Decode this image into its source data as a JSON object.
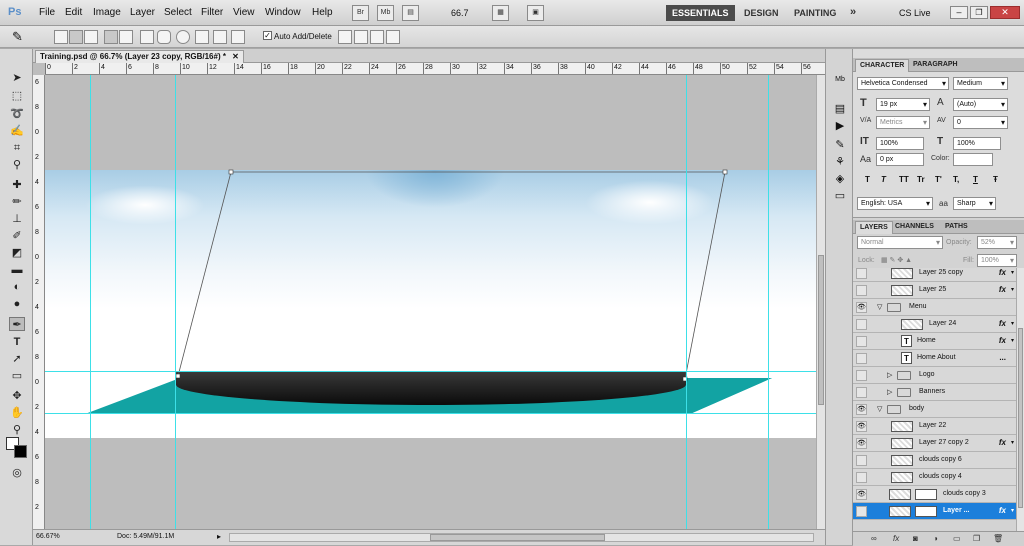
{
  "menubar": {
    "app_logo": "Ps",
    "items": [
      "File",
      "Edit",
      "Image",
      "Layer",
      "Select",
      "Filter",
      "View",
      "Window",
      "Help"
    ],
    "bridge": "Br",
    "minibridge": "Mb",
    "zoom": "66.7",
    "workspaces": [
      "ESSENTIALS",
      "DESIGN",
      "PAINTING"
    ],
    "more": "»",
    "cslive": "CS Live"
  },
  "options": {
    "auto_add_delete": "Auto Add/Delete",
    "auto_checked": true
  },
  "document": {
    "tab_title": "Training.psd @ 66.7% (Layer 23 copy, RGB/16#) *",
    "ruler_marks": [
      "0",
      "2",
      "4",
      "6",
      "8",
      "10",
      "12",
      "14",
      "16",
      "18",
      "20",
      "22",
      "24",
      "26",
      "28",
      "30",
      "32",
      "34",
      "36",
      "38",
      "40",
      "42",
      "44",
      "46",
      "48",
      "50",
      "52",
      "54",
      "56",
      "58"
    ],
    "vruler_marks": [
      "6",
      "8",
      "0",
      "2",
      "4",
      "6",
      "8",
      "0",
      "2",
      "4",
      "6",
      "8",
      "0",
      "2",
      "4",
      "6",
      "8",
      "2"
    ],
    "status_zoom": "66.67%",
    "status_doc": "Doc: 5.49M/91.1M"
  },
  "character": {
    "tabs": [
      "CHARACTER",
      "PARAGRAPH"
    ],
    "font_family": "Helvetica Condensed",
    "font_style": "Medium",
    "font_size": "19 px",
    "leading": "(Auto)",
    "kerning": "Metrics",
    "tracking": "0",
    "vscale": "100%",
    "hscale": "100%",
    "baseline": "0 px",
    "color_label": "Color:",
    "style_buttons": [
      "T",
      "T",
      "TT",
      "Tr",
      "T'",
      "T,",
      "T",
      "Ŧ"
    ],
    "language": "English: USA",
    "aa_icon": "aa",
    "antialias": "Sharp"
  },
  "layers": {
    "tabs": [
      "LAYERS",
      "CHANNELS",
      "PATHS"
    ],
    "blend": "Normal",
    "opacity_label": "Opacity:",
    "opacity": "52%",
    "lock_label": "Lock:",
    "fill_label": "Fill:",
    "fill": "100%",
    "rows": [
      {
        "name": "Layer 25 copy",
        "kind": "pixel",
        "indent": 2,
        "eye": false,
        "fx": true
      },
      {
        "name": "Layer 25",
        "kind": "pixel",
        "indent": 2,
        "eye": false,
        "fx": true
      },
      {
        "name": "Menu",
        "kind": "group-open",
        "indent": 1,
        "eye": true,
        "fx": false
      },
      {
        "name": "Layer 24",
        "kind": "pixel",
        "indent": 3,
        "eye": false,
        "fx": true
      },
      {
        "name": "Home",
        "kind": "text",
        "indent": 3,
        "eye": false,
        "fx": true
      },
      {
        "name": "Home      About",
        "kind": "text",
        "indent": 3,
        "eye": false,
        "fx": false,
        "dots": "..."
      },
      {
        "name": "Logo",
        "kind": "group",
        "indent": 2,
        "eye": false,
        "fx": false
      },
      {
        "name": "Banners",
        "kind": "group",
        "indent": 2,
        "eye": false,
        "fx": false
      },
      {
        "name": "body",
        "kind": "group-open",
        "indent": 1,
        "eye": true,
        "fx": false
      },
      {
        "name": "Layer 22",
        "kind": "pixel",
        "indent": 2,
        "eye": true,
        "fx": false
      },
      {
        "name": "Layer 27 copy 2",
        "kind": "pixel",
        "indent": 2,
        "eye": true,
        "fx": true
      },
      {
        "name": "clouds copy 6",
        "kind": "pixel",
        "indent": 2,
        "eye": false,
        "fx": false
      },
      {
        "name": "clouds copy 4",
        "kind": "pixel",
        "indent": 2,
        "eye": false,
        "fx": false
      },
      {
        "name": "clouds copy 3",
        "kind": "masked",
        "indent": 2,
        "eye": true,
        "fx": false
      },
      {
        "name": "Layer ...",
        "kind": "masked",
        "indent": 2,
        "eye": false,
        "fx": true,
        "selected": true
      }
    ]
  },
  "colors": {
    "teal": "#12a3a3",
    "selection": "#1c7fdb",
    "guide": "#3de0e8"
  }
}
